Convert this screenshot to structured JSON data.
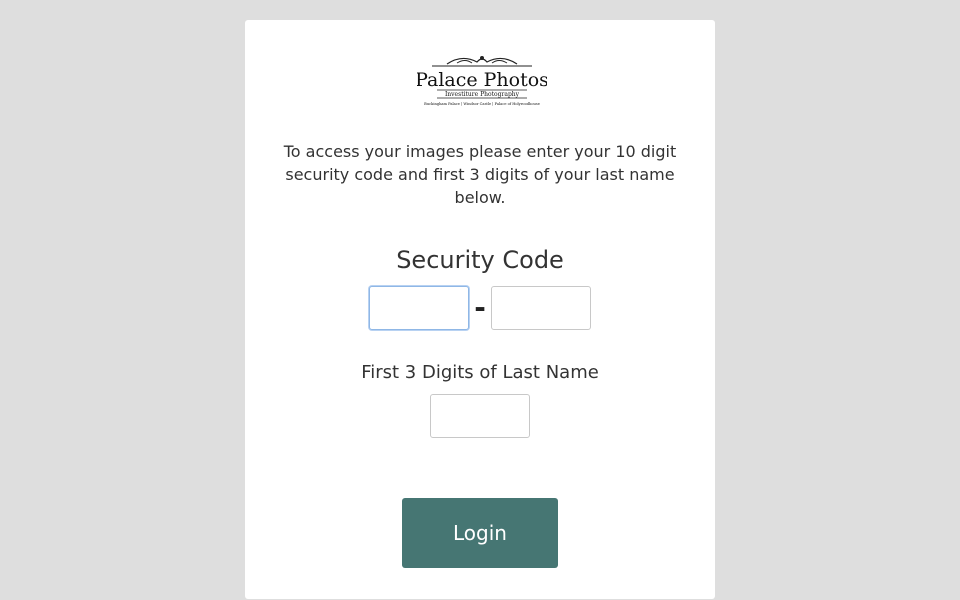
{
  "logo": {
    "title": "Palace Photos",
    "tagline": "Investiture Photography",
    "locations": "Buckingham Palace | Windsor Castle | Palace of Holyroodhouse"
  },
  "intro_text": "To access your images please enter your 10 digit security code and first 3 digits of your last name below.",
  "security_code": {
    "label": "Security Code",
    "separator": "-",
    "part1_value": "",
    "part2_value": ""
  },
  "last_name": {
    "label": "First 3 Digits of Last Name",
    "value": ""
  },
  "login_button": {
    "label": "Login"
  },
  "colors": {
    "background": "#dedede",
    "card": "#ffffff",
    "button": "#467673",
    "focus_border": "#8fb7e6"
  }
}
